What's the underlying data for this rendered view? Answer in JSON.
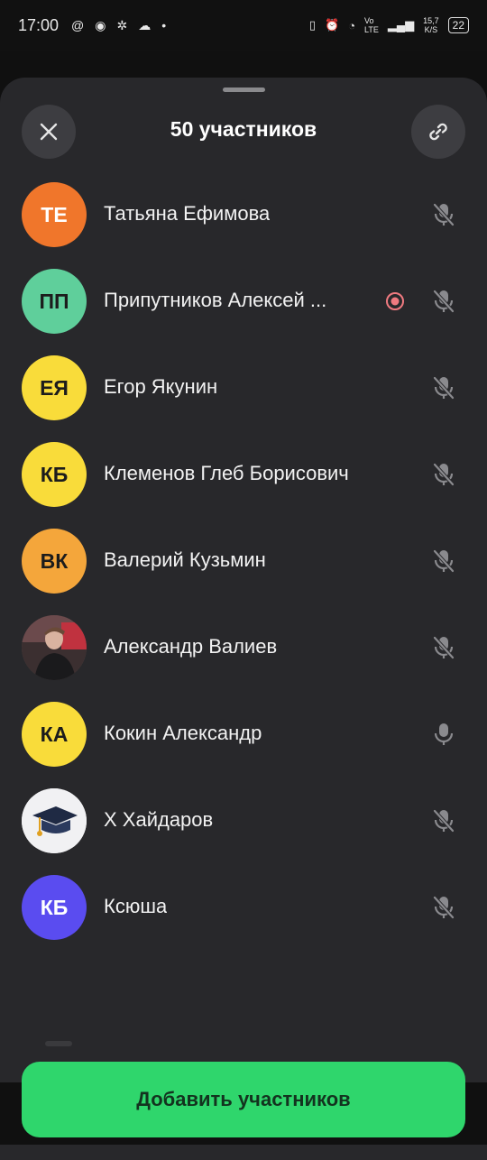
{
  "status_bar": {
    "time": "17:00",
    "network_speed": "15,7",
    "network_unit": "K/S",
    "net_type_top": "Vo",
    "net_type_bottom": "LTE",
    "battery": "22"
  },
  "header": {
    "title": "50 участников",
    "close_icon": "close-icon",
    "link_icon": "link-icon"
  },
  "participants": [
    {
      "initials": "ТЕ",
      "name": "Татьяна Ефимова",
      "avatar_color": "#f0762b",
      "initials_color": "#ffffff",
      "mic": "muted"
    },
    {
      "initials": "ПП",
      "name": "Припутников Алексей ...",
      "avatar_color": "#5fcf9b",
      "initials_color": "#1c1c1c",
      "mic": "muted",
      "recording": true
    },
    {
      "initials": "ЕЯ",
      "name": "Егор Якунин",
      "avatar_color": "#f9dc3a",
      "initials_color": "#1c1c1c",
      "mic": "muted"
    },
    {
      "initials": "КБ",
      "name": "Клеменов Глеб Борисович",
      "avatar_color": "#f9dc3a",
      "initials_color": "#1c1c1c",
      "mic": "muted"
    },
    {
      "initials": "ВК",
      "name": "Валерий Кузьмин",
      "avatar_color": "#f4a63b",
      "initials_color": "#1c1c1c",
      "mic": "muted"
    },
    {
      "initials": "",
      "name": "Александр Валиев",
      "avatar_color": "#5a4a48",
      "initials_color": "#ffffff",
      "mic": "muted",
      "photo": true
    },
    {
      "initials": "КА",
      "name": "Кокин Александр",
      "avatar_color": "#f9dc3a",
      "initials_color": "#1c1c1c",
      "mic": "on"
    },
    {
      "initials": "",
      "name": "Х Хайдаров",
      "avatar_color": "#f1f1f3",
      "initials_color": "#1c1c1c",
      "mic": "muted",
      "graduation_cap": true
    },
    {
      "initials": "КБ",
      "name": "Ксюша",
      "avatar_color": "#5a4cf0",
      "initials_color": "#ffffff",
      "mic": "muted"
    }
  ],
  "footer": {
    "add_button": "Добавить участников",
    "accent": "#2fd66c"
  }
}
